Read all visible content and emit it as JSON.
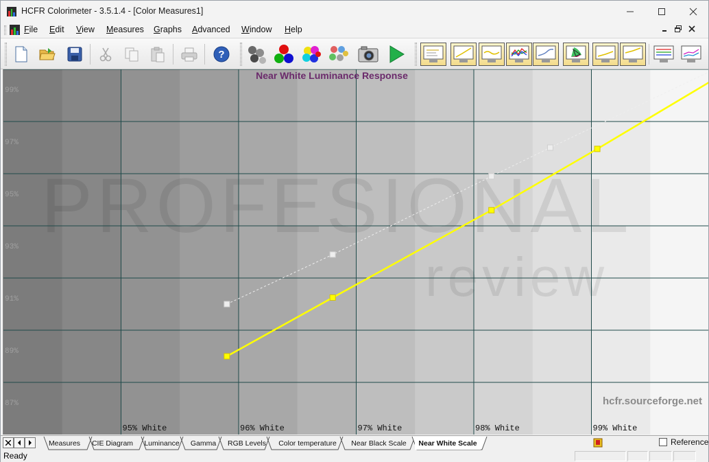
{
  "window": {
    "title": "HCFR Colorimeter - 3.5.1.4 - [Color Measures1]"
  },
  "menu": {
    "items": [
      {
        "label": "File",
        "accel": "F"
      },
      {
        "label": "Edit",
        "accel": "E"
      },
      {
        "label": "View",
        "accel": "V"
      },
      {
        "label": "Measures",
        "accel": "M"
      },
      {
        "label": "Graphs",
        "accel": "G"
      },
      {
        "label": "Advanced",
        "accel": "A"
      },
      {
        "label": "Window",
        "accel": "W"
      },
      {
        "label": "Help",
        "accel": "H"
      }
    ]
  },
  "toolbar": {
    "buttons": [
      {
        "name": "new-document-icon"
      },
      {
        "name": "open-folder-icon"
      },
      {
        "name": "save-disk-icon"
      },
      {
        "name": "cut-icon",
        "disabled": true
      },
      {
        "name": "copy-icon",
        "disabled": true
      },
      {
        "name": "paste-icon",
        "disabled": true
      },
      {
        "name": "print-icon",
        "disabled": true
      },
      {
        "name": "help-icon"
      },
      {
        "name": "measure-grayscale-icon"
      },
      {
        "name": "measure-primaries-icon"
      },
      {
        "name": "measure-secondaries-icon"
      },
      {
        "name": "measure-saturations-icon"
      },
      {
        "name": "camera-icon"
      },
      {
        "name": "play-icon"
      },
      {
        "name": "graph-measures-icon"
      },
      {
        "name": "graph-luminance-icon"
      },
      {
        "name": "graph-gamma-icon"
      },
      {
        "name": "graph-rgb-levels-icon"
      },
      {
        "name": "graph-color-temperature-icon"
      },
      {
        "name": "graph-cie-diagram-icon"
      },
      {
        "name": "graph-near-black-icon"
      },
      {
        "name": "graph-near-white-icon"
      },
      {
        "name": "graph-saturation-shift-icon"
      },
      {
        "name": "graph-saturation-luminance-icon"
      }
    ]
  },
  "chart_data": {
    "type": "line",
    "title": "Near White Luminance Response",
    "categories": [
      "95% White",
      "96% White",
      "97% White",
      "98% White",
      "99% White"
    ],
    "x": [
      95,
      96,
      97,
      98,
      99
    ],
    "xlim": [
      94,
      100
    ],
    "ylim": [
      86,
      100
    ],
    "y_ticks": [
      "87%",
      "89%",
      "91%",
      "93%",
      "95%",
      "97%",
      "99%"
    ],
    "y_tick_values": [
      87,
      89,
      91,
      93,
      95,
      97,
      99
    ],
    "grid": true,
    "series": [
      {
        "color": "#ffff00",
        "style": "solid",
        "x": [
          95.9,
          96.8,
          98.15,
          99.05,
          100
        ],
        "values": [
          89.0,
          91.25,
          94.6,
          96.95,
          99.5
        ]
      },
      {
        "color": "#eeeeee",
        "style": "dashed",
        "x": [
          95.9,
          96.8,
          98.15,
          98.65,
          100
        ],
        "values": [
          91.0,
          92.9,
          95.9,
          97.0,
          99.9
        ]
      }
    ],
    "watermark": "hcfr.sourceforge.net",
    "background_watermark_text": [
      "PROFESIONAL",
      "review"
    ]
  },
  "tabs": {
    "items": [
      {
        "label": "Measures"
      },
      {
        "label": "CIE Diagram"
      },
      {
        "label": "Luminance"
      },
      {
        "label": "Gamma"
      },
      {
        "label": "RGB Levels"
      },
      {
        "label": "Color temperature"
      },
      {
        "label": "Near Black Scale"
      },
      {
        "label": "Near White Scale",
        "active": true
      }
    ],
    "reference_label": "Reference",
    "reference_checked": false
  },
  "status": {
    "text": "Ready"
  },
  "colors": {
    "title_purple": "#6b2a6b",
    "watermark_gray": "#8a8a8a",
    "tick_gray": "#a0a0a0",
    "grid": "#1f4a4a",
    "axis_label": "#111111"
  }
}
